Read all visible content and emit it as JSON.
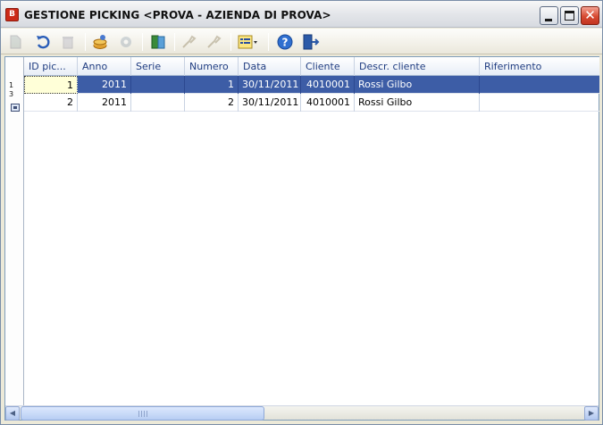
{
  "window": {
    "title": "GESTIONE PICKING <PROVA - AZIENDA DI PROVA>",
    "close_glyph": "✕"
  },
  "toolbar": {
    "icons": [
      "new-icon",
      "undo-icon",
      "delete-icon",
      "db-user-icon",
      "gear-icon",
      "book-icon",
      "search-icon",
      "search-all-icon",
      "list-options-icon",
      "help-icon",
      "exit-icon"
    ]
  },
  "grid": {
    "row_header": {
      "line1": "1",
      "line2": "3"
    },
    "columns": [
      "ID pic...",
      "Anno",
      "Serie",
      "Numero",
      "Data",
      "Cliente",
      "Descr. cliente",
      "Riferimento"
    ],
    "rows": [
      {
        "id": "1",
        "anno": "2011",
        "serie": "",
        "numero": "1",
        "data": "30/11/2011",
        "cliente": "4010001",
        "descr": "Rossi Gilbo",
        "rif": ""
      },
      {
        "id": "2",
        "anno": "2011",
        "serie": "",
        "numero": "2",
        "data": "30/11/2011",
        "cliente": "4010001",
        "descr": "Rossi Gilbo",
        "rif": ""
      }
    ]
  },
  "colors": {
    "selection": "#3d5da6",
    "header_text": "#1f3c80"
  }
}
